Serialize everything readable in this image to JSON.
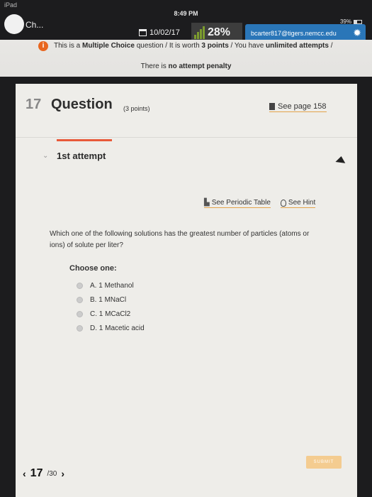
{
  "status_bar": {
    "carrier": "iPad",
    "time": "8:49 PM",
    "battery": "39%"
  },
  "app_bar": {
    "back_label": "Ch...",
    "date": "10/02/17",
    "score_percent": "28%",
    "score_icon_label": "SCORE",
    "email": "bcarter817@tigers.nemcc.edu",
    "accent_color": "#2a76b8"
  },
  "notice": {
    "line1_prefix": "This is a ",
    "line1_bold1": "Multiple Choice",
    "line1_mid": " question / It is worth ",
    "line1_bold2": "3 points",
    "line1_mid2": " / You have ",
    "line1_bold3": "unlimited attempts",
    "line1_suffix": " /",
    "line2_prefix": "There is ",
    "line2_bold": "no attempt penalty"
  },
  "question": {
    "number": "17",
    "title": "Question",
    "points": "(3 points)",
    "page_link": "See page 158",
    "attempt": "1st attempt",
    "tools": {
      "periodic_table": "See Periodic Table",
      "hint": "See Hint"
    },
    "text": "Which one of the following solutions has the greatest number of particles (atoms or ions) of solute per liter?",
    "choose_label": "Choose one:",
    "options": [
      "A. 1 Methanol",
      "B. 1 MNaCl",
      "C. 1 MCaCl2",
      "D. 1 Macetic acid"
    ]
  },
  "footer": {
    "current": "17",
    "total": "/30",
    "submit_label": "SUBMIT"
  }
}
